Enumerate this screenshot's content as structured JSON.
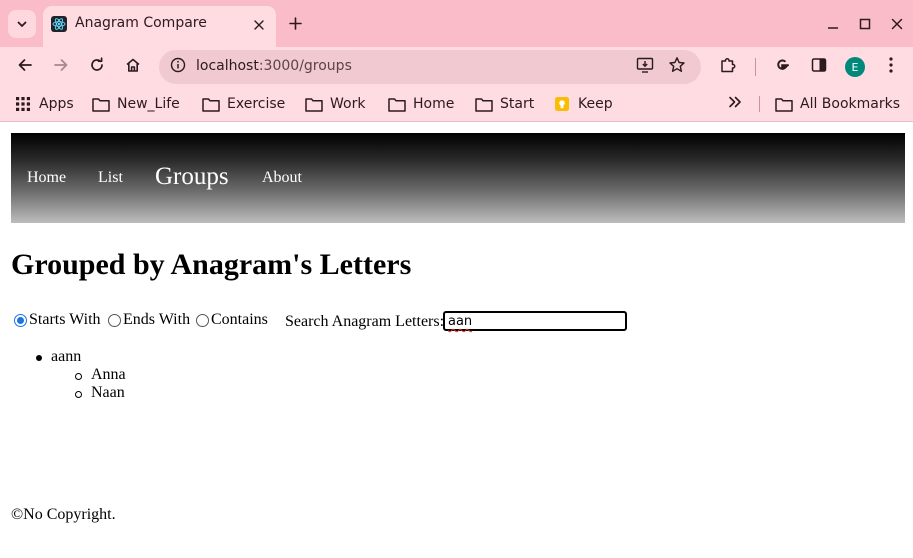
{
  "browser": {
    "tab": {
      "title": "Anagram Compare"
    },
    "address_bar": {
      "host": "localhost",
      "rest": ":3000/groups"
    },
    "profile_initial": "E",
    "bookmarks": [
      {
        "label": "Apps",
        "icon": "apps-grid-icon"
      },
      {
        "label": "New_Life",
        "icon": "folder-icon"
      },
      {
        "label": "Exercise",
        "icon": "folder-icon"
      },
      {
        "label": "Work",
        "icon": "folder-icon"
      },
      {
        "label": "Home",
        "icon": "folder-icon"
      },
      {
        "label": "Start",
        "icon": "folder-icon"
      },
      {
        "label": "Keep",
        "icon": "keep-icon"
      }
    ],
    "all_bookmarks_label": "All Bookmarks"
  },
  "nav": {
    "links": [
      "Home",
      "List",
      "Groups",
      "About"
    ],
    "active": "Groups"
  },
  "page": {
    "title": "Grouped by Anagram's Letters",
    "filters": {
      "options": [
        "Starts With",
        "Ends With",
        "Contains"
      ],
      "selected": "Starts With"
    },
    "search": {
      "label": "Search Anagram Letters:",
      "value": "aan"
    },
    "groups": [
      {
        "key": "aann",
        "words": [
          "Anna",
          "Naan"
        ]
      }
    ],
    "footer": "©No Copyright."
  },
  "colors": {
    "chrome_titlebar": "#fbbcc9",
    "chrome_toolbar": "#ffdbe2",
    "radio_accent": "#1a73e8",
    "profile_avatar": "#00897b"
  }
}
